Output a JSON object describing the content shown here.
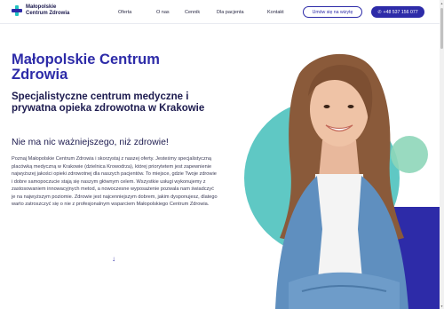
{
  "header": {
    "logo_line1": "Małopolskie",
    "logo_line2": "Centrum Zdrowia",
    "nav": [
      "Oferta",
      "O nas",
      "Cennik",
      "Dla pacjenta",
      "Kontakt"
    ],
    "appointment_button": "Umów się na wizytę",
    "phone_button": "+48 537 156 077"
  },
  "hero": {
    "title": "Małopolskie Centrum Zdrowia",
    "subtitle": "Specjalistyczne centrum medyczne i prywatna opieka zdrowotna w Krakowie",
    "tagline": "Nie ma nic ważniejszego, niż zdrowie!",
    "body": "Poznaj Małopolskie Centrum Zdrowia i skorzystaj z naszej oferty. Jesteśmy specjalistyczną placówką medyczną w Krakowie (dzielnica Krowodrza), której priorytetem jest zapewnienie najwyższej jakości opieki zdrowotnej dla naszych pacjentów. To miejsce, gdzie Twoje zdrowie i dobre samopoczucie stają się naszym głównym celem. Wszystkie usługi wykonujemy z zastosowaniem innowacyjnych metod, a nowoczesne wyposażenie pozwala nam świadczyć je na najwyższym poziomie. Zdrowie jest najcenniejszym dobrem, jakim dysponujesz, dlatego warto zatroszczyć się o nie z profesjonalnym wsparciem Małopolskiego Centrum Zdrowia."
  },
  "colors": {
    "brand_navy": "#2d2ba8",
    "brand_teal": "#5fc8c4",
    "brand_green": "#8ed6b9"
  },
  "icons": {
    "scroll_down": "arrow-down-icon",
    "phone": "phone-icon",
    "logo": "medical-cross-icon"
  }
}
